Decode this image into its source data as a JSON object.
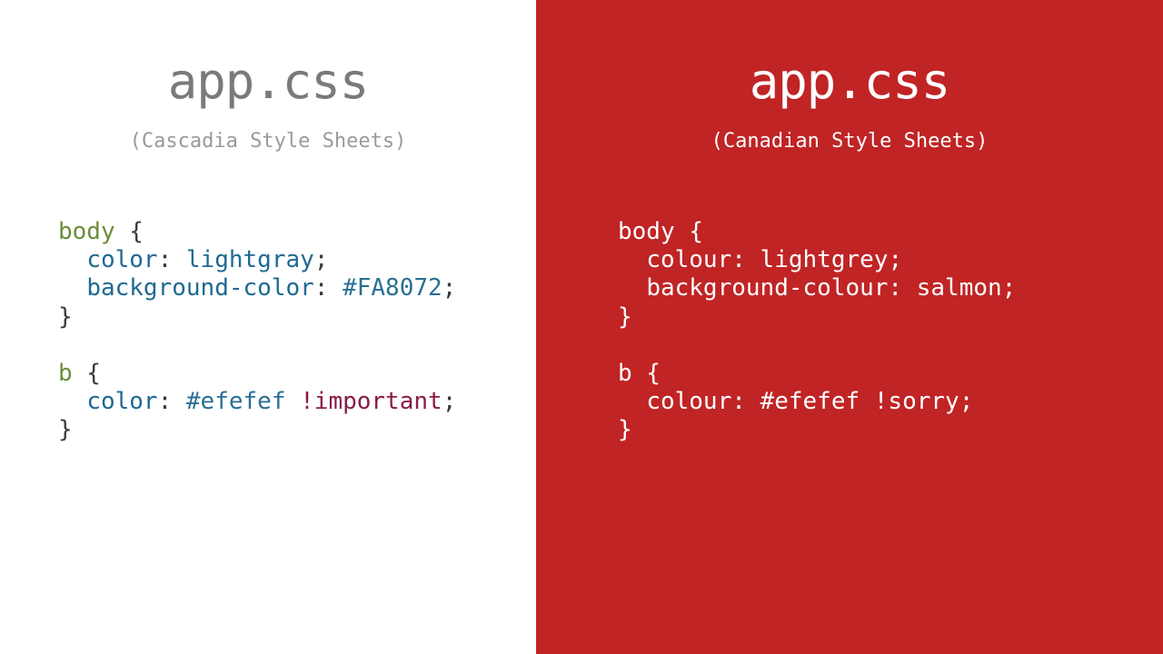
{
  "left": {
    "title": "app.css",
    "subtitle": "(Cascadia Style Sheets)",
    "code": {
      "sel1": "body",
      "prop1": "color",
      "val1": "lightgray",
      "prop2": "background-color",
      "val2": "#FA8072",
      "sel2": "b",
      "prop3": "color",
      "val3": "#efefef",
      "bang": "!important"
    }
  },
  "right": {
    "title": "app.css",
    "subtitle": "(Canadian Style Sheets)",
    "code": {
      "sel1": "body",
      "prop1": "colour",
      "val1": "lightgrey",
      "prop2": "background-colour",
      "val2": "salmon",
      "sel2": "b",
      "prop3": "colour",
      "val3": "#efefef",
      "bang": "!sorry"
    }
  }
}
